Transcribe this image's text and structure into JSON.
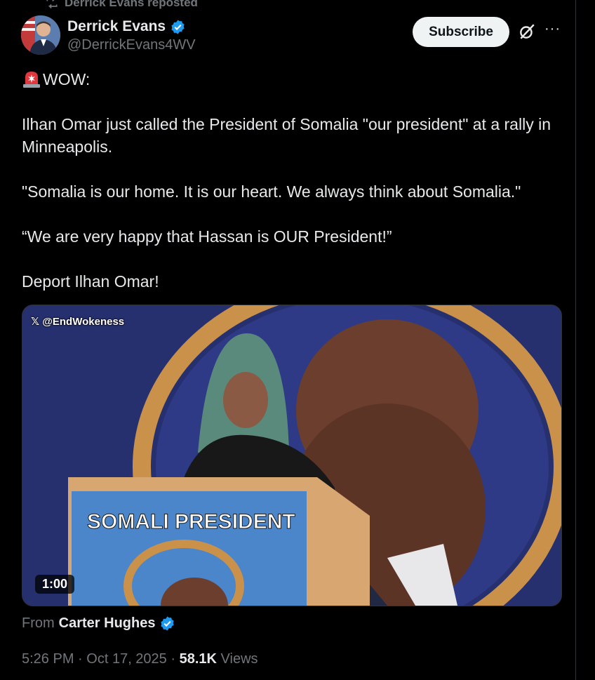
{
  "repost": {
    "label": "Derrick Evans reposted"
  },
  "author": {
    "name": "Derrick Evans",
    "handle": "@DerrickEvans4WV"
  },
  "actions": {
    "subscribe": "Subscribe",
    "more": "···"
  },
  "tweet": {
    "heading": "WOW:",
    "paragraphs": [
      "Ilhan Omar just called the President of Somalia \"our president\" at a rally in Minneapolis.",
      "\"Somalia is our home. It is our heart. We always think about Somalia.\"",
      "“We are very happy that Hassan is OUR President!”",
      "Deport Ilhan Omar!"
    ]
  },
  "media": {
    "watermark": "@EndWokeness",
    "podium_text": "SOMALI PRESIDENT",
    "duration": "1:00"
  },
  "attribution": {
    "prefix": "From",
    "name": "Carter Hughes"
  },
  "meta": {
    "time": "5:26 PM",
    "date": "Oct 17, 2025",
    "views_count": "58.1K",
    "views_label": "Views",
    "separator": "·"
  },
  "colors": {
    "background": "#000000",
    "text": "#e7e9ea",
    "muted": "#71767b",
    "verified": "#1d9bf0",
    "button_bg": "#eff3f4"
  }
}
